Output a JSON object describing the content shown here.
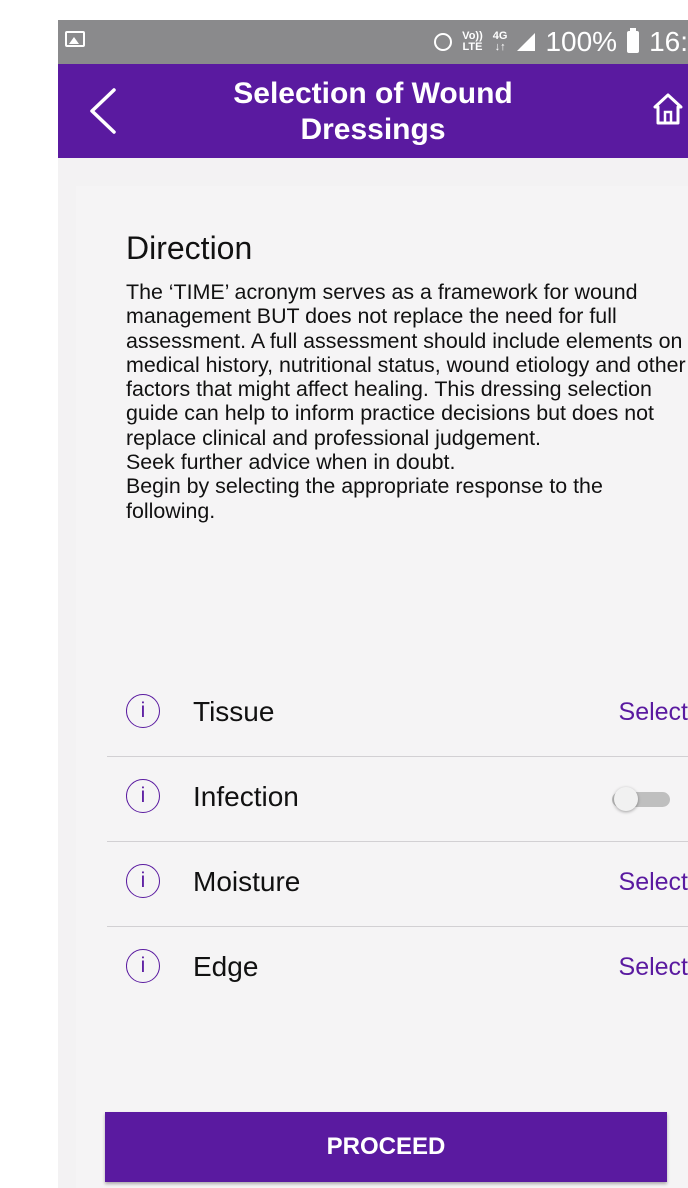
{
  "status_bar": {
    "volte_top": "Vo))",
    "volte_bottom": "LTE",
    "net_top": "4G",
    "net_bottom": "↓↑",
    "battery": "100%",
    "time": "16:"
  },
  "app_bar": {
    "title_line1": "Selection of Wound",
    "title_line2": "Dressings",
    "back_icon": "back-chevron-icon",
    "home_icon": "home-icon"
  },
  "direction": {
    "title": "Direction",
    "paragraphs": [
      "The ‘TIME’ acronym serves as a framework for wound management BUT does not replace the need for full assessment. A full assessment should include elements on medical history, nutritional status, wound etiology and other factors that might affect healing. This dressing selection guide can help to inform practice decisions but does not replace clinical and professional judgement.",
      "Seek further advice when in doubt.",
      "Begin by selecting the appropriate response to the following."
    ]
  },
  "rows": [
    {
      "label": "Tissue",
      "action": "Select"
    },
    {
      "label": "Infection",
      "toggle_on": false
    },
    {
      "label": "Moisture",
      "action": "Select"
    },
    {
      "label": "Edge",
      "action": "Select"
    }
  ],
  "info_glyph": "i",
  "proceed_label": "PROCEED",
  "colors": {
    "primary": "#5a1aa0",
    "status_bar": "#8a8a8c",
    "background": "#f3f2f3"
  }
}
